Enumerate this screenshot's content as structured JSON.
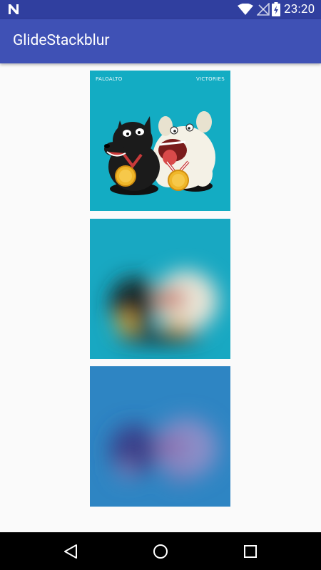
{
  "status_bar": {
    "time": "23:20",
    "icons": [
      "notification-n-icon",
      "wifi-icon",
      "no-signal-icon",
      "battery-charging-icon"
    ]
  },
  "app_bar": {
    "title": "GlideStackblur",
    "color": "#3f51b5",
    "status_color": "#303f9f"
  },
  "images": [
    {
      "label_left": "PALOALTO",
      "label_right": "VICTORIES",
      "effect": "original",
      "color": "#13acc3"
    },
    {
      "effect": "blurred",
      "color": "#18a8c2"
    },
    {
      "effect": "blurred-tinted",
      "color": "#2e85c3"
    }
  ],
  "nav_bar": {
    "buttons": [
      "back-icon",
      "home-icon",
      "recents-icon"
    ]
  }
}
